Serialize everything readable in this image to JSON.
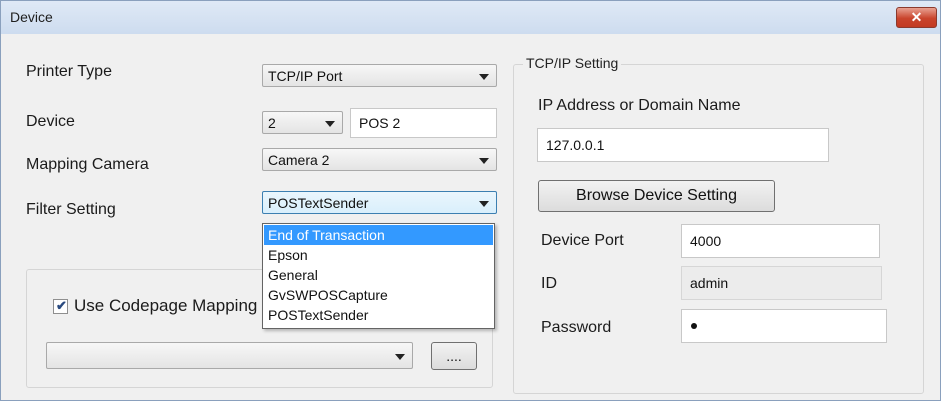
{
  "window": {
    "title": "Device",
    "close_glyph": "✕"
  },
  "left": {
    "printer_type": {
      "label": "Printer Type",
      "value": "TCP/IP Port"
    },
    "device": {
      "label": "Device",
      "number": "2",
      "name": "POS 2"
    },
    "mapping_camera": {
      "label": "Mapping Camera",
      "value": "Camera 2"
    },
    "filter_setting": {
      "label": "Filter Setting",
      "value": "POSTextSender",
      "options": [
        "End of Transaction",
        "Epson",
        "General",
        "GvSWPOSCapture",
        "POSTextSender"
      ],
      "highlighted_index": 0
    },
    "codepage": {
      "checkbox_label": "Use Codepage Mapping",
      "checked": true,
      "value": "",
      "browse_label": "...."
    }
  },
  "tcpip": {
    "group_title": "TCP/IP Setting",
    "address_label": "IP Address or Domain Name",
    "address_value": "127.0.0.1",
    "browse_button": "Browse Device Setting",
    "port_label": "Device Port",
    "port_value": "4000",
    "id_label": "ID",
    "id_value": "admin",
    "password_label": "Password"
  }
}
